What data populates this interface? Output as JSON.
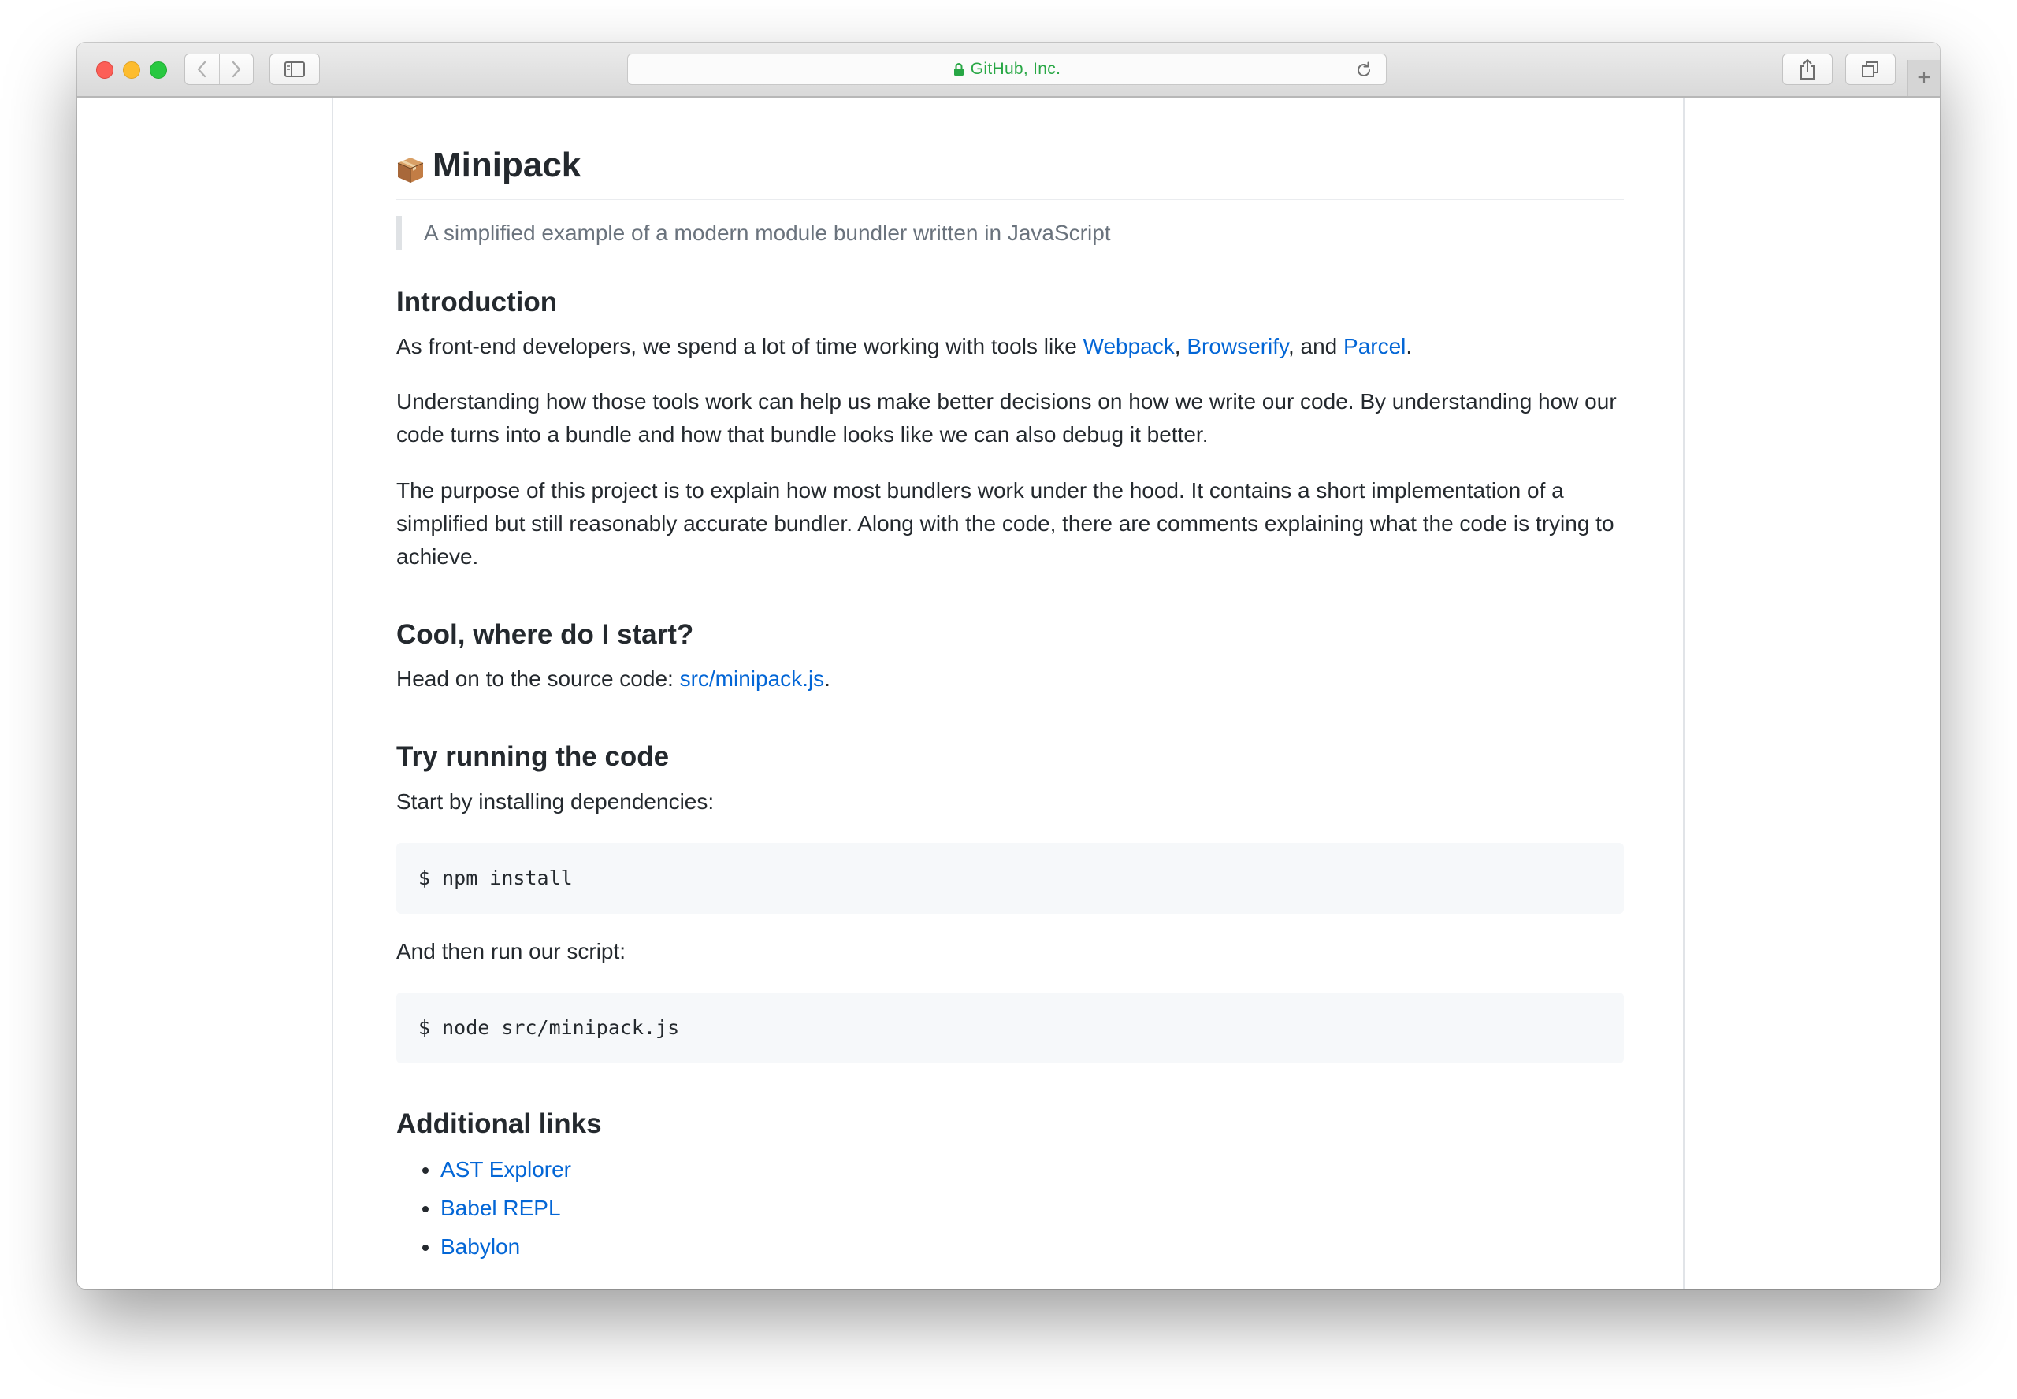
{
  "browser": {
    "address_label": "GitHub, Inc.",
    "new_tab_label": "+"
  },
  "readme": {
    "title": "Minipack",
    "tagline": "A simplified example of a modern module bundler written in JavaScript",
    "intro": {
      "heading": "Introduction",
      "p1_before": "As front-end developers, we spend a lot of time working with tools like ",
      "p1_link1": "Webpack",
      "p1_sep1": ", ",
      "p1_link2": "Browserify",
      "p1_sep2": ", and ",
      "p1_link3": "Parcel",
      "p1_after": ".",
      "p2": "Understanding how those tools work can help us make better decisions on how we write our code. By understanding how our code turns into a bundle and how that bundle looks like we can also debug it better.",
      "p3": "The purpose of this project is to explain how most bundlers work under the hood. It contains a short implementation of a simplified but still reasonably accurate bundler. Along with the code, there are comments explaining what the code is trying to achieve."
    },
    "start": {
      "heading": "Cool, where do I start?",
      "text_before": "Head on to the source code: ",
      "link": "src/minipack.js",
      "text_after": "."
    },
    "run": {
      "heading": "Try running the code",
      "install_text": "Start by installing dependencies:",
      "install_cmd": "$ npm install",
      "run_text": "And then run our script:",
      "run_cmd": "$ node src/minipack.js"
    },
    "additional": {
      "heading": "Additional links",
      "items": [
        "AST Explorer",
        "Babel REPL",
        "Babylon"
      ]
    }
  },
  "colors": {
    "link": "#0366d6",
    "text": "#24292e",
    "muted": "#6a737d",
    "secure_green": "#28a745"
  }
}
